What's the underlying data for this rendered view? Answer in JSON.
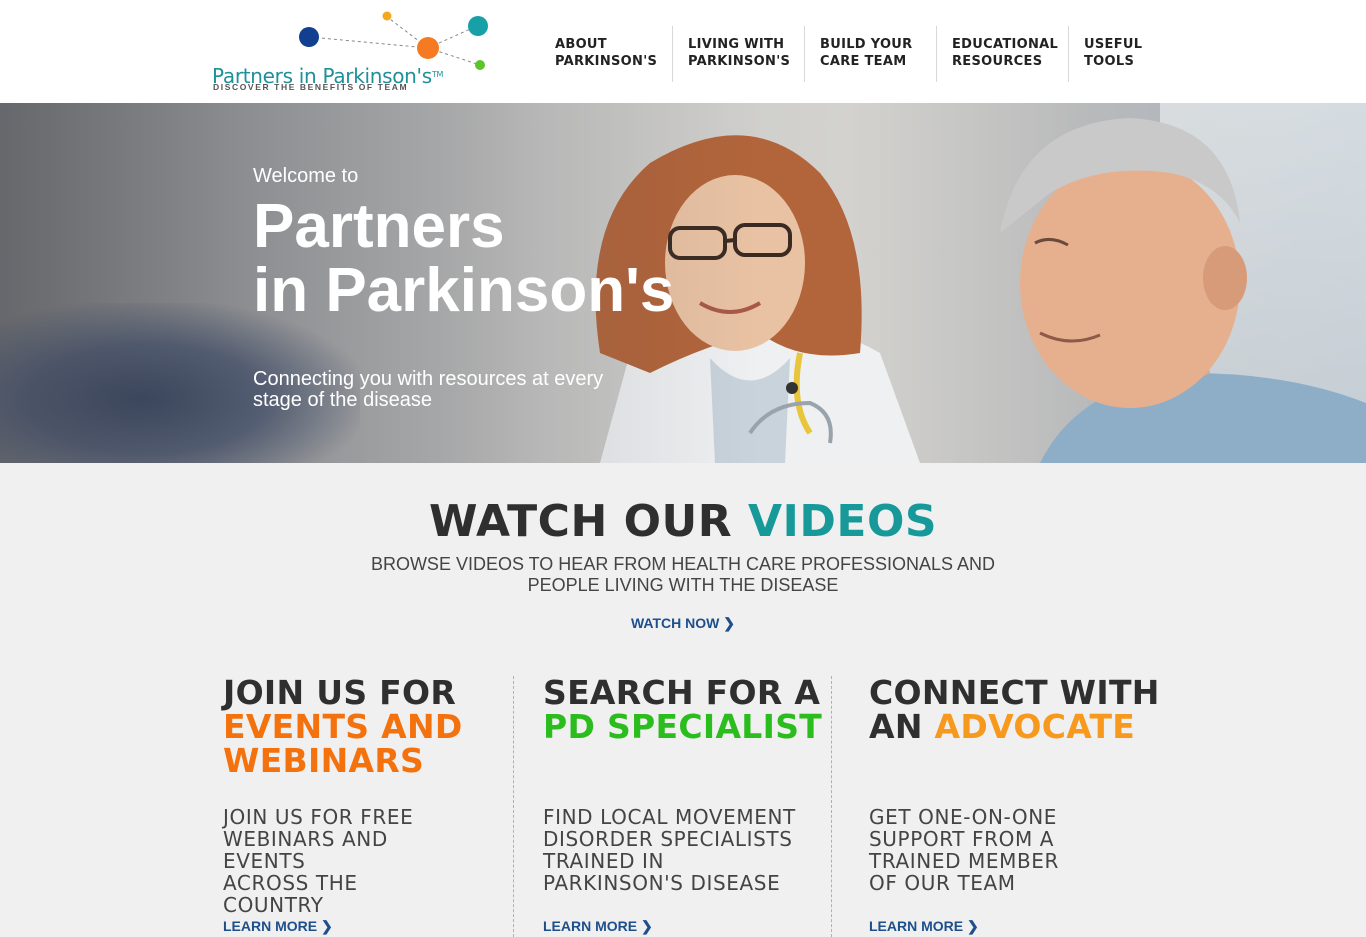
{
  "header": {
    "logo": {
      "name": "Partners in Parkinson's",
      "trademark": "TM",
      "tagline": "DISCOVER THE BENEFITS OF TEAM"
    },
    "nav": [
      {
        "label": "ABOUT\nPARKINSON'S"
      },
      {
        "label": "LIVING WITH\nPARKINSON'S"
      },
      {
        "label": "BUILD YOUR\nCARE TEAM"
      },
      {
        "label": "EDUCATIONAL\nRESOURCES"
      },
      {
        "label": "USEFUL\nTOOLS"
      }
    ]
  },
  "hero": {
    "welcome": "Welcome to",
    "title": "Partners\nin Parkinson's",
    "subtitle": "Connecting you with resources at every stage of the disease"
  },
  "videos": {
    "title_part1": "WATCH OUR ",
    "title_part2": "VIDEOS",
    "subtitle": "BROWSE VIDEOS TO HEAR FROM HEALTH CARE PROFESSIONALS AND PEOPLE LIVING WITH THE DISEASE",
    "cta": "WATCH NOW ❯"
  },
  "columns": [
    {
      "title_line1": "JOIN US FOR",
      "title_highlight": "EVENTS AND",
      "title_highlight2": "WEBINARS",
      "description": "JOIN US FOR FREE\nWEBINARS AND EVENTS\nACROSS THE COUNTRY",
      "cta": "LEARN MORE ❯"
    },
    {
      "title_line1": "SEARCH FOR A",
      "title_highlight": "PD SPECIALIST",
      "description": "FIND LOCAL MOVEMENT\nDISORDER SPECIALISTS\nTRAINED IN\nPARKINSON'S DISEASE",
      "cta": "LEARN MORE ❯"
    },
    {
      "title_line1": "CONNECT WITH",
      "title_prefix": "AN ",
      "title_highlight": "ADVOCATE",
      "description": "GET ONE-ON-ONE\nSUPPORT FROM A\nTRAINED MEMBER\nOF OUR TEAM",
      "cta": "LEARN MORE ❯"
    }
  ],
  "colors": {
    "teal": "#17999a",
    "orange": "#f4720e",
    "green": "#2bbd1d",
    "amber": "#f7991c",
    "link_blue": "#1c4f8c"
  }
}
